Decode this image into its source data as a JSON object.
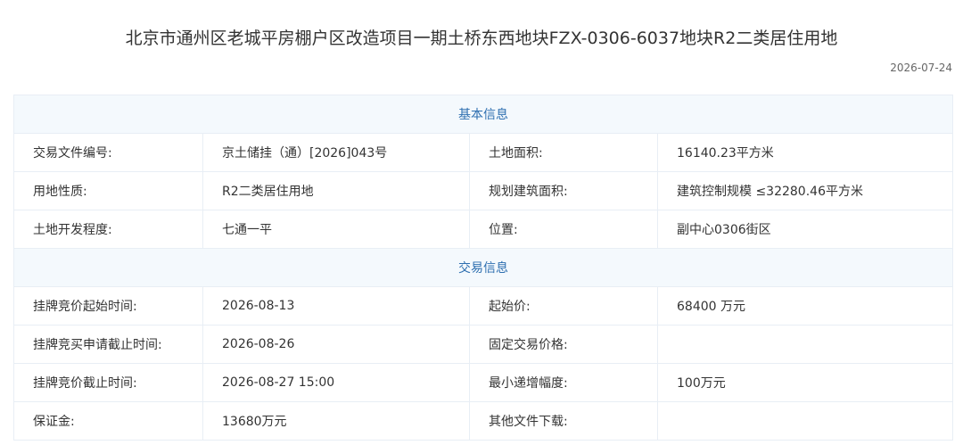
{
  "page": {
    "title": "北京市通州区老城平房棚户区改造项目一期土桥东西地块FZX-0306-6037地块R2二类居住用地",
    "date": "2026-07-24"
  },
  "sections": {
    "basic": "基本信息",
    "trade": "交易信息"
  },
  "basic_rows": [
    {
      "label1": "交易文件编号:",
      "value1": "京土储挂（通）[2026]043号",
      "label2": "土地面积:",
      "value2": "16140.23平方米"
    },
    {
      "label1": "用地性质:",
      "value1": "R2二类居住用地",
      "label2": "规划建筑面积:",
      "value2": "建筑控制规模 ≤32280.46平方米"
    },
    {
      "label1": "土地开发程度:",
      "value1": "七通一平",
      "label2": "位置:",
      "value2": "副中心0306街区"
    }
  ],
  "trade_rows": [
    {
      "label1": "挂牌竞价起始时间:",
      "value1": "2026-08-13",
      "label2": "起始价:",
      "value2": "68400 万元"
    },
    {
      "label1": "挂牌竞买申请截止时间:",
      "value1": "2026-08-26",
      "label2": "固定交易价格:",
      "value2": ""
    },
    {
      "label1": "挂牌竞价截止时间:",
      "value1": "2026-08-27 15:00",
      "label2": "最小递增幅度:",
      "value2": "100万元"
    },
    {
      "label1": "保证金:",
      "value1": "13680万元",
      "label2": "其他文件下载:",
      "value2": ""
    }
  ],
  "colors": {
    "section_text": "#2e6fb0",
    "section_bg": "#f4f9fd",
    "border": "#e8eef5"
  }
}
